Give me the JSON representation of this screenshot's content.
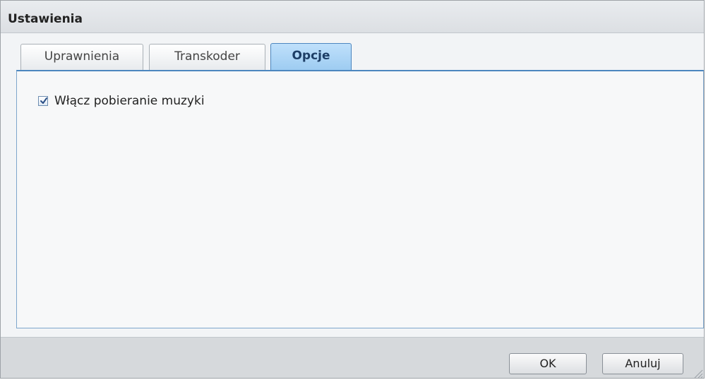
{
  "window": {
    "title": "Ustawienia"
  },
  "tabs": [
    {
      "label": "Uprawnienia",
      "active": false
    },
    {
      "label": "Transkoder",
      "active": false
    },
    {
      "label": "Opcje",
      "active": true
    }
  ],
  "options": {
    "music_download": {
      "label": "Włącz pobieranie muzyki",
      "checked": true
    }
  },
  "footer": {
    "ok_label": "OK",
    "cancel_label": "Anuluj"
  },
  "colors": {
    "active_tab": "#9ccbf1",
    "panel_border": "#4c86bf",
    "window_bg": "#dfe3e7"
  },
  "icons": {
    "check": "checkmark-icon",
    "resize": "resize-grip-icon"
  }
}
